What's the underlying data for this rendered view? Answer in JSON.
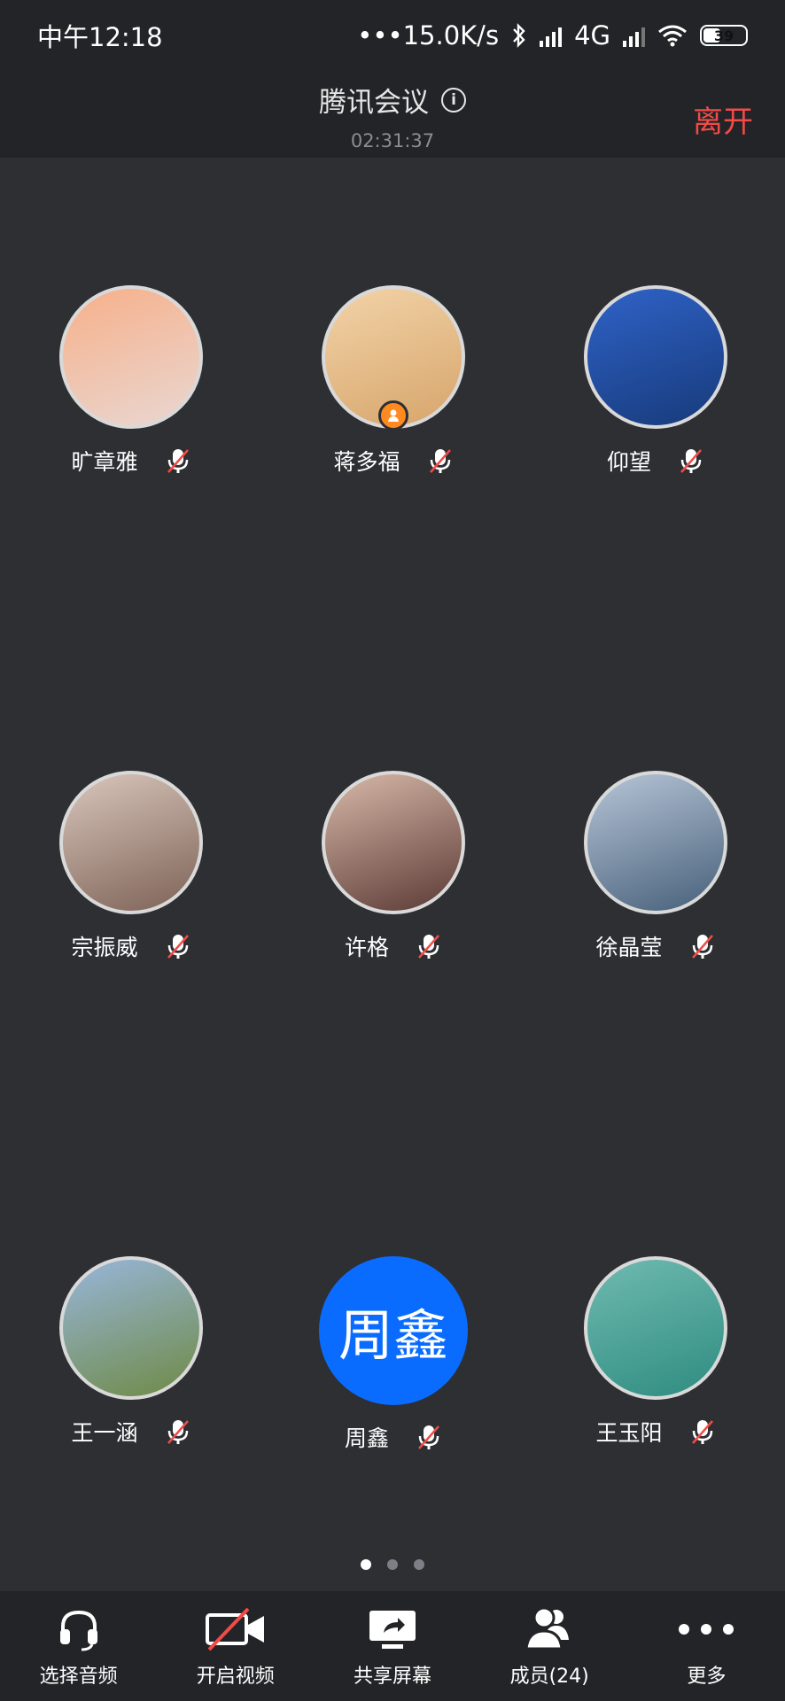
{
  "status_bar": {
    "time": "中午12:18",
    "network_speed": "•••15.0K/s",
    "network_type": "4G",
    "battery": "39"
  },
  "header": {
    "title": "腾讯会议",
    "duration": "02:31:37",
    "leave_label": "离开"
  },
  "participants": [
    {
      "name": "旷章雅",
      "avatar_kind": "photo",
      "avatar_colors": [
        "#f7b08a",
        "#e9d7d2"
      ],
      "muted": true
    },
    {
      "name": "蒋多福",
      "avatar_kind": "photo",
      "avatar_colors": [
        "#f2d3a8",
        "#d7a56b"
      ],
      "muted": true,
      "host": true
    },
    {
      "name": "仰望",
      "avatar_kind": "photo",
      "avatar_colors": [
        "#2f63c8",
        "#173a7a"
      ],
      "muted": true
    },
    {
      "name": "宗振威",
      "avatar_kind": "photo",
      "avatar_colors": [
        "#d9c6bb",
        "#7d6257"
      ],
      "muted": true
    },
    {
      "name": "许格",
      "avatar_kind": "photo",
      "avatar_colors": [
        "#d8b8a8",
        "#5a3a35"
      ],
      "muted": true
    },
    {
      "name": "徐晶莹",
      "avatar_kind": "photo",
      "avatar_colors": [
        "#b7c5d7",
        "#47607a"
      ],
      "muted": true
    },
    {
      "name": "王一涵",
      "avatar_kind": "photo",
      "avatar_colors": [
        "#98b6db",
        "#6e8a45"
      ],
      "muted": true
    },
    {
      "name": "周鑫",
      "avatar_kind": "initials",
      "avatar_text": "周鑫",
      "avatar_colors": [
        "#0a6cff"
      ],
      "muted": true
    },
    {
      "name": "王玉阳",
      "avatar_kind": "photo",
      "avatar_colors": [
        "#6fbab0",
        "#2f8c80"
      ],
      "muted": true
    }
  ],
  "pagination": {
    "pages": 3,
    "current": 1
  },
  "toolbar": {
    "audio_label": "选择音频",
    "video_label": "开启视频",
    "share_label": "共享屏幕",
    "members_label": "成员(24)",
    "more_label": "更多"
  },
  "colors": {
    "background": "#2d2f33",
    "bar": "#232427",
    "leave": "#f24b47",
    "muted_slash": "#f24b47",
    "host_badge": "#ff8a1f",
    "initials_avatar": "#0a6cff"
  }
}
